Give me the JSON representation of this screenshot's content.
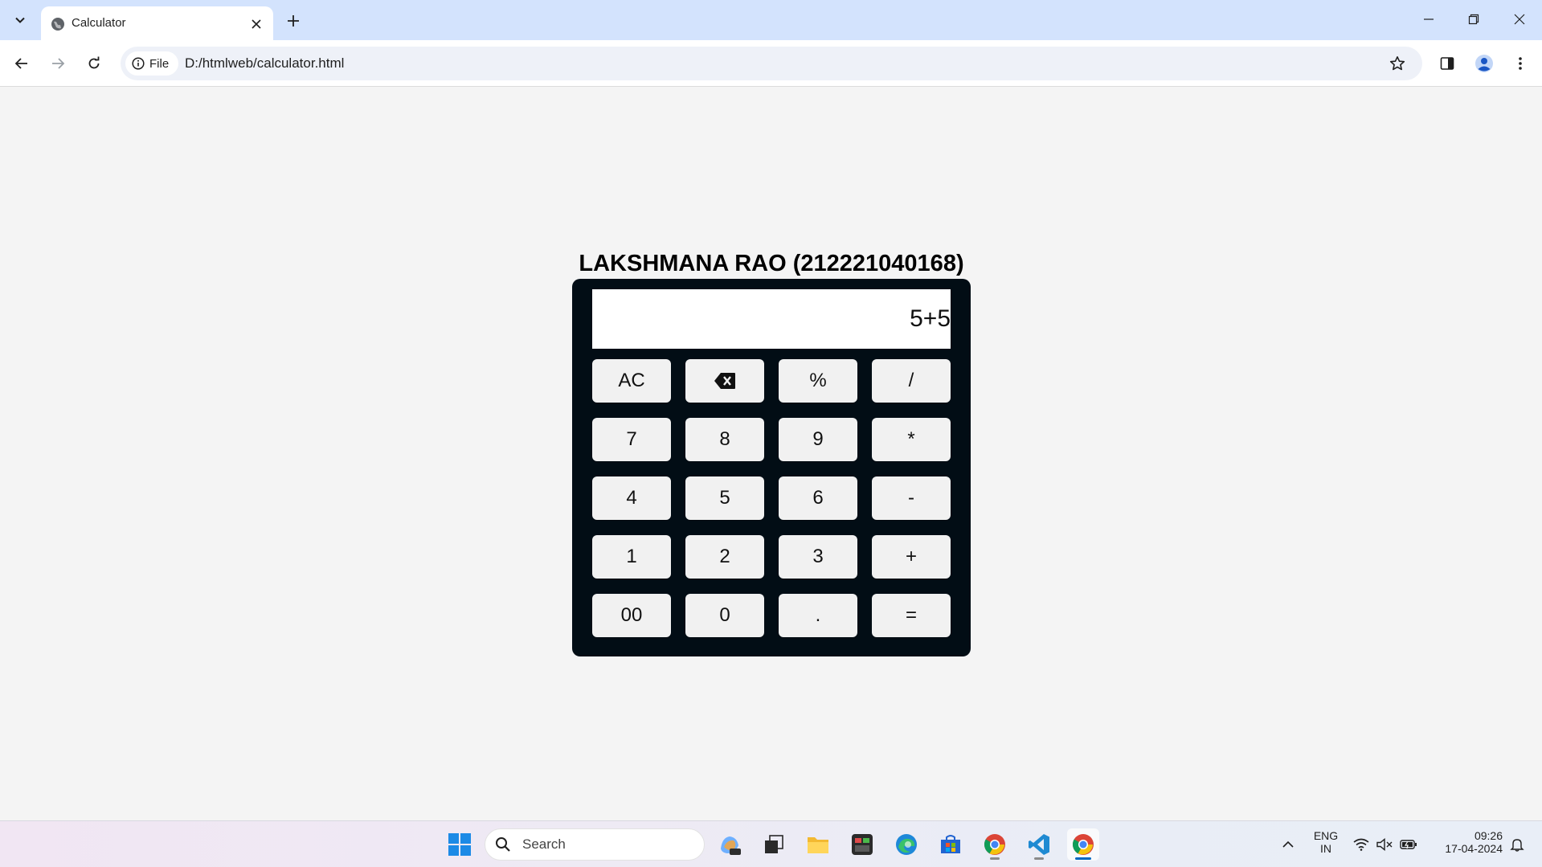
{
  "browser": {
    "tab_title": "Calculator",
    "site_chip_label": "File",
    "url": "D:/htmlweb/calculator.html"
  },
  "page": {
    "title": "LAKSHMANA RAO (212221040168)",
    "display_value": "5+5",
    "keys": [
      {
        "label": "AC",
        "name": "key-clear-all"
      },
      {
        "label": "",
        "name": "key-backspace",
        "icon": "backspace-icon"
      },
      {
        "label": "%",
        "name": "key-percent"
      },
      {
        "label": "/",
        "name": "key-divide"
      },
      {
        "label": "7",
        "name": "key-7"
      },
      {
        "label": "8",
        "name": "key-8"
      },
      {
        "label": "9",
        "name": "key-9"
      },
      {
        "label": "*",
        "name": "key-multiply"
      },
      {
        "label": "4",
        "name": "key-4"
      },
      {
        "label": "5",
        "name": "key-5"
      },
      {
        "label": "6",
        "name": "key-6"
      },
      {
        "label": "-",
        "name": "key-subtract"
      },
      {
        "label": "1",
        "name": "key-1"
      },
      {
        "label": "2",
        "name": "key-2"
      },
      {
        "label": "3",
        "name": "key-3"
      },
      {
        "label": "+",
        "name": "key-add"
      },
      {
        "label": "00",
        "name": "key-double-zero"
      },
      {
        "label": "0",
        "name": "key-0"
      },
      {
        "label": ".",
        "name": "key-decimal"
      },
      {
        "label": "=",
        "name": "key-equals"
      }
    ]
  },
  "taskbar": {
    "search_placeholder": "Search",
    "language_line1": "ENG",
    "language_line2": "IN",
    "time": "09:26",
    "date": "17-04-2024"
  },
  "colors": {
    "tab_strip": "#d3e3fd",
    "page_background": "#f4f4f4",
    "calculator_body": "#020d15",
    "key_background": "#f1f1f1"
  }
}
